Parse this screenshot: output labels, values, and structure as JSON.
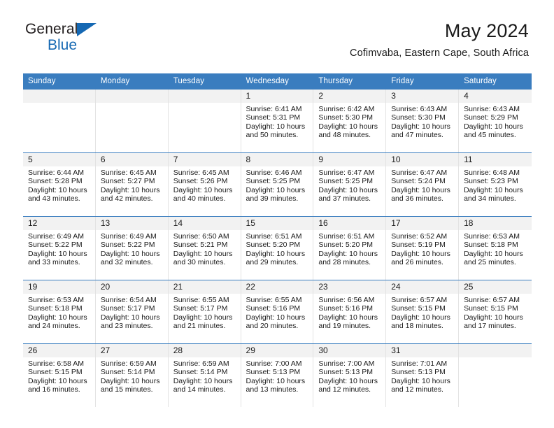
{
  "brand": {
    "name_part1": "General",
    "name_part2": "Blue",
    "logo_icon": "triangle-logo-icon"
  },
  "header": {
    "title": "May 2024",
    "subtitle": "Cofimvaba, Eastern Cape, South Africa"
  },
  "weekday_headers": [
    "Sunday",
    "Monday",
    "Tuesday",
    "Wednesday",
    "Thursday",
    "Friday",
    "Saturday"
  ],
  "colors": {
    "header_blue": "#3a7dbf",
    "brand_blue": "#1568b3",
    "daynum_bg": "#f2f2f2",
    "text": "#1a1a1a"
  },
  "weeks": [
    [
      {
        "empty": true
      },
      {
        "empty": true
      },
      {
        "empty": true
      },
      {
        "day": "1",
        "sunrise": "Sunrise: 6:41 AM",
        "sunset": "Sunset: 5:31 PM",
        "daylight": "Daylight: 10 hours and 50 minutes."
      },
      {
        "day": "2",
        "sunrise": "Sunrise: 6:42 AM",
        "sunset": "Sunset: 5:30 PM",
        "daylight": "Daylight: 10 hours and 48 minutes."
      },
      {
        "day": "3",
        "sunrise": "Sunrise: 6:43 AM",
        "sunset": "Sunset: 5:30 PM",
        "daylight": "Daylight: 10 hours and 47 minutes."
      },
      {
        "day": "4",
        "sunrise": "Sunrise: 6:43 AM",
        "sunset": "Sunset: 5:29 PM",
        "daylight": "Daylight: 10 hours and 45 minutes."
      }
    ],
    [
      {
        "day": "5",
        "sunrise": "Sunrise: 6:44 AM",
        "sunset": "Sunset: 5:28 PM",
        "daylight": "Daylight: 10 hours and 43 minutes."
      },
      {
        "day": "6",
        "sunrise": "Sunrise: 6:45 AM",
        "sunset": "Sunset: 5:27 PM",
        "daylight": "Daylight: 10 hours and 42 minutes."
      },
      {
        "day": "7",
        "sunrise": "Sunrise: 6:45 AM",
        "sunset": "Sunset: 5:26 PM",
        "daylight": "Daylight: 10 hours and 40 minutes."
      },
      {
        "day": "8",
        "sunrise": "Sunrise: 6:46 AM",
        "sunset": "Sunset: 5:25 PM",
        "daylight": "Daylight: 10 hours and 39 minutes."
      },
      {
        "day": "9",
        "sunrise": "Sunrise: 6:47 AM",
        "sunset": "Sunset: 5:25 PM",
        "daylight": "Daylight: 10 hours and 37 minutes."
      },
      {
        "day": "10",
        "sunrise": "Sunrise: 6:47 AM",
        "sunset": "Sunset: 5:24 PM",
        "daylight": "Daylight: 10 hours and 36 minutes."
      },
      {
        "day": "11",
        "sunrise": "Sunrise: 6:48 AM",
        "sunset": "Sunset: 5:23 PM",
        "daylight": "Daylight: 10 hours and 34 minutes."
      }
    ],
    [
      {
        "day": "12",
        "sunrise": "Sunrise: 6:49 AM",
        "sunset": "Sunset: 5:22 PM",
        "daylight": "Daylight: 10 hours and 33 minutes."
      },
      {
        "day": "13",
        "sunrise": "Sunrise: 6:49 AM",
        "sunset": "Sunset: 5:22 PM",
        "daylight": "Daylight: 10 hours and 32 minutes."
      },
      {
        "day": "14",
        "sunrise": "Sunrise: 6:50 AM",
        "sunset": "Sunset: 5:21 PM",
        "daylight": "Daylight: 10 hours and 30 minutes."
      },
      {
        "day": "15",
        "sunrise": "Sunrise: 6:51 AM",
        "sunset": "Sunset: 5:20 PM",
        "daylight": "Daylight: 10 hours and 29 minutes."
      },
      {
        "day": "16",
        "sunrise": "Sunrise: 6:51 AM",
        "sunset": "Sunset: 5:20 PM",
        "daylight": "Daylight: 10 hours and 28 minutes."
      },
      {
        "day": "17",
        "sunrise": "Sunrise: 6:52 AM",
        "sunset": "Sunset: 5:19 PM",
        "daylight": "Daylight: 10 hours and 26 minutes."
      },
      {
        "day": "18",
        "sunrise": "Sunrise: 6:53 AM",
        "sunset": "Sunset: 5:18 PM",
        "daylight": "Daylight: 10 hours and 25 minutes."
      }
    ],
    [
      {
        "day": "19",
        "sunrise": "Sunrise: 6:53 AM",
        "sunset": "Sunset: 5:18 PM",
        "daylight": "Daylight: 10 hours and 24 minutes."
      },
      {
        "day": "20",
        "sunrise": "Sunrise: 6:54 AM",
        "sunset": "Sunset: 5:17 PM",
        "daylight": "Daylight: 10 hours and 23 minutes."
      },
      {
        "day": "21",
        "sunrise": "Sunrise: 6:55 AM",
        "sunset": "Sunset: 5:17 PM",
        "daylight": "Daylight: 10 hours and 21 minutes."
      },
      {
        "day": "22",
        "sunrise": "Sunrise: 6:55 AM",
        "sunset": "Sunset: 5:16 PM",
        "daylight": "Daylight: 10 hours and 20 minutes."
      },
      {
        "day": "23",
        "sunrise": "Sunrise: 6:56 AM",
        "sunset": "Sunset: 5:16 PM",
        "daylight": "Daylight: 10 hours and 19 minutes."
      },
      {
        "day": "24",
        "sunrise": "Sunrise: 6:57 AM",
        "sunset": "Sunset: 5:15 PM",
        "daylight": "Daylight: 10 hours and 18 minutes."
      },
      {
        "day": "25",
        "sunrise": "Sunrise: 6:57 AM",
        "sunset": "Sunset: 5:15 PM",
        "daylight": "Daylight: 10 hours and 17 minutes."
      }
    ],
    [
      {
        "day": "26",
        "sunrise": "Sunrise: 6:58 AM",
        "sunset": "Sunset: 5:15 PM",
        "daylight": "Daylight: 10 hours and 16 minutes."
      },
      {
        "day": "27",
        "sunrise": "Sunrise: 6:59 AM",
        "sunset": "Sunset: 5:14 PM",
        "daylight": "Daylight: 10 hours and 15 minutes."
      },
      {
        "day": "28",
        "sunrise": "Sunrise: 6:59 AM",
        "sunset": "Sunset: 5:14 PM",
        "daylight": "Daylight: 10 hours and 14 minutes."
      },
      {
        "day": "29",
        "sunrise": "Sunrise: 7:00 AM",
        "sunset": "Sunset: 5:13 PM",
        "daylight": "Daylight: 10 hours and 13 minutes."
      },
      {
        "day": "30",
        "sunrise": "Sunrise: 7:00 AM",
        "sunset": "Sunset: 5:13 PM",
        "daylight": "Daylight: 10 hours and 12 minutes."
      },
      {
        "day": "31",
        "sunrise": "Sunrise: 7:01 AM",
        "sunset": "Sunset: 5:13 PM",
        "daylight": "Daylight: 10 hours and 12 minutes."
      },
      {
        "empty": true
      }
    ]
  ]
}
